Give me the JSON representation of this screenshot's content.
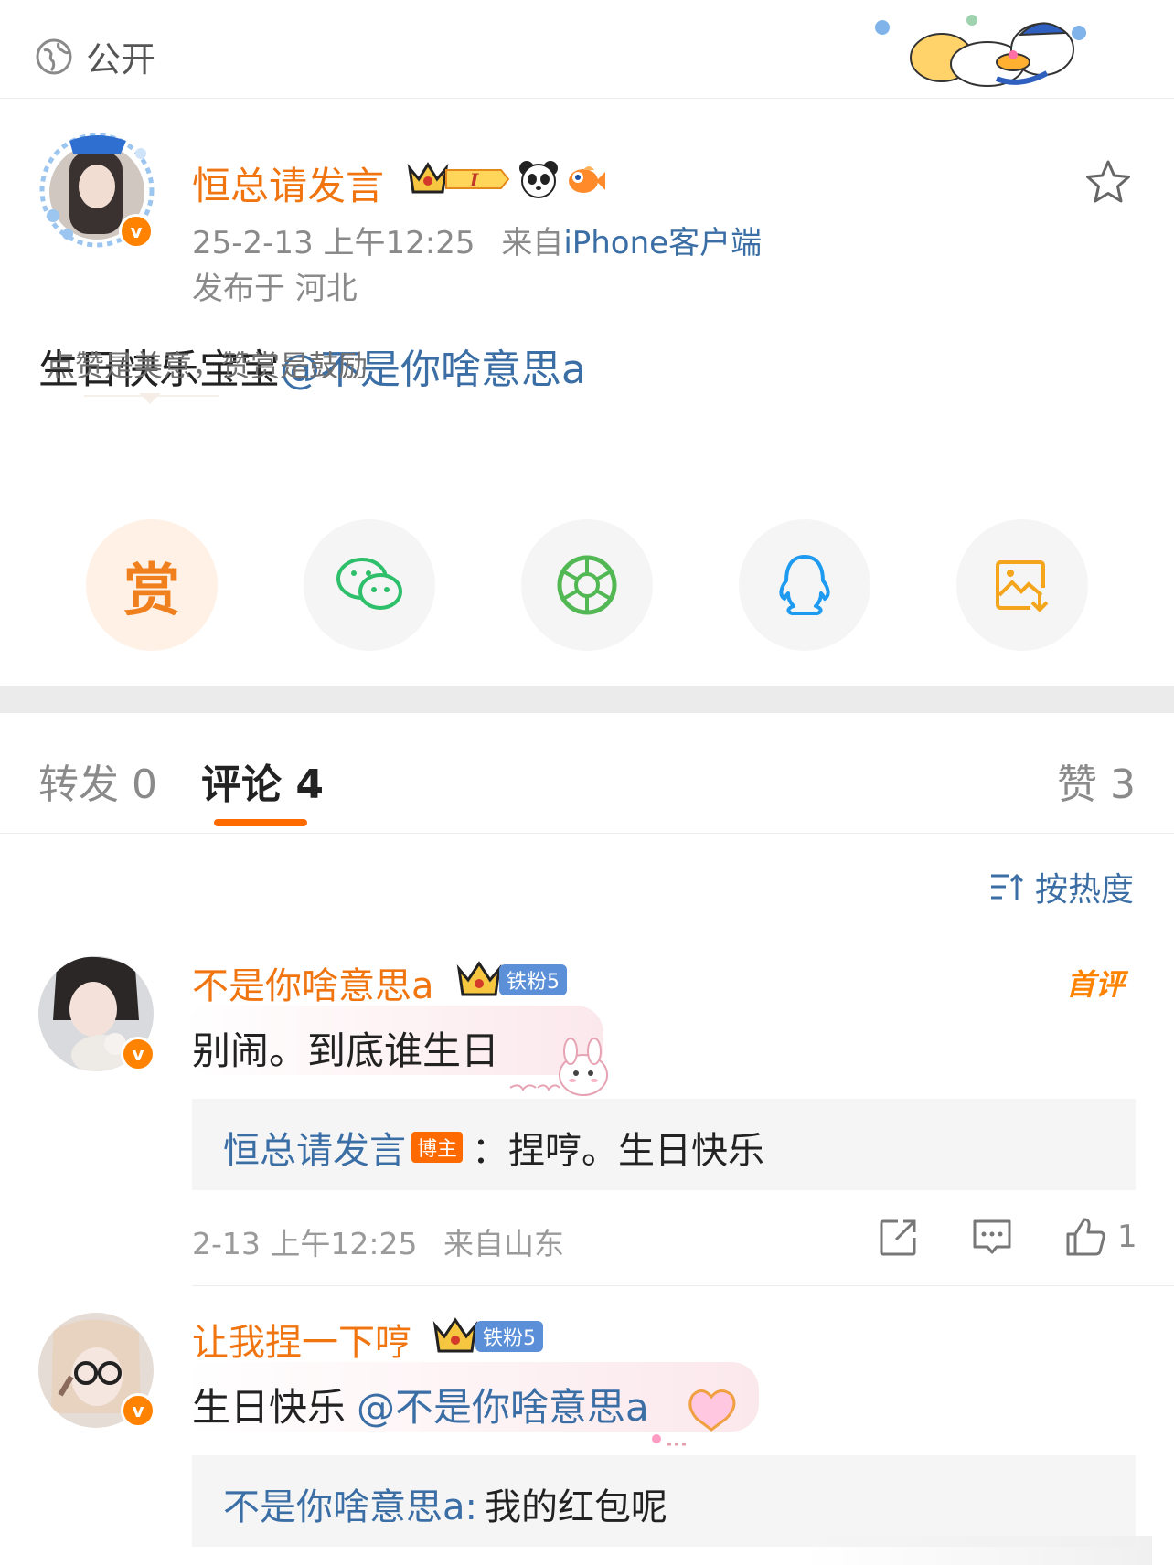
{
  "topbar": {
    "visibility_label": "公开",
    "visibility_icon": "globe-icon"
  },
  "post": {
    "author": "恒总请发言",
    "level": "I",
    "timestamp": "25-2-13 上午12:25",
    "source_prefix": "来自",
    "source": "iPhone客户端",
    "location": "发布于 河北",
    "text": "生日快乐宝宝",
    "mention": "@不是你啥意思a",
    "verified_icon": "v",
    "star_icon": "star-icon"
  },
  "reward": {
    "tip": "点赞是美意，赞赏是鼓励",
    "reward_label": "赏",
    "share_icons": [
      "reward-icon",
      "wechat-icon",
      "moments-icon",
      "qq-icon",
      "save-image-icon"
    ]
  },
  "tabs": {
    "repost": "转发 0",
    "comments": "评论 4",
    "likes": "赞 3"
  },
  "sort": {
    "label": "按热度",
    "icon": "sort-icon"
  },
  "comments": [
    {
      "name": "不是你啥意思a",
      "fan_badge": "铁粉5",
      "tag": "首评",
      "text": "别闹。到底谁生日",
      "reply": {
        "name": "恒总请发言",
        "owner_tag": "博主",
        "text": "：捏哼。生日快乐"
      },
      "time": "2-13 上午12:25",
      "location": "来自山东",
      "likes": "1"
    },
    {
      "name": "让我捏一下哼",
      "fan_badge": "铁粉5",
      "text": "生日快乐",
      "mention": "@不是你啥意思a",
      "reply": {
        "name": "不是你啥意思a:",
        "text": "我的红包呢"
      }
    }
  ],
  "colors": {
    "accent_orange": "#ff8200",
    "name_orange": "#f0740f",
    "link_blue": "#3a6ea5",
    "fan_badge_blue": "#5b8fd8"
  }
}
